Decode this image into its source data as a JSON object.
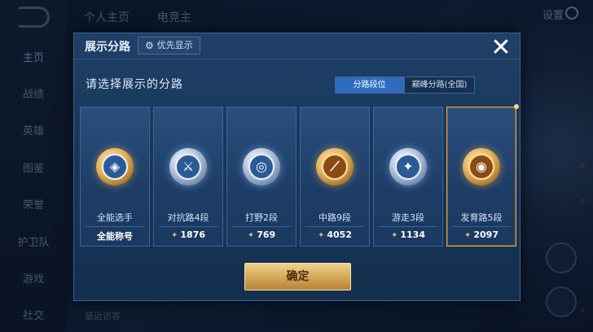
{
  "background": {
    "top_tabs": [
      "个人主页",
      "电竞主"
    ],
    "settings_label": "设置",
    "nav_items": [
      "主页",
      "战绩",
      "英雄",
      "图鉴",
      "荣誉",
      "护卫队",
      "游戏",
      "社交"
    ],
    "bottom_hint": "最近访客"
  },
  "dialog": {
    "title": "展示分路",
    "priority_button": "优先显示",
    "close_symbol": "✕",
    "prompt": "请选择展示的分路",
    "segments": [
      "分路段位",
      "巅峰分路(全国)"
    ],
    "cards": [
      {
        "label": "全能选手",
        "score": "全能称号",
        "emblem": "allround-emblem-icon",
        "glyph": "◈",
        "style": "gold-ring"
      },
      {
        "label": "对抗路4段",
        "score": "1876",
        "emblem": "clash-lane-emblem-icon",
        "glyph": "⚔",
        "style": "silver"
      },
      {
        "label": "打野2段",
        "score": "769",
        "emblem": "jungle-emblem-icon",
        "glyph": "◎",
        "style": "silver"
      },
      {
        "label": "中路9段",
        "score": "4052",
        "emblem": "mid-lane-emblem-icon",
        "glyph": "⟋",
        "style": "gold"
      },
      {
        "label": "游走3段",
        "score": "1134",
        "emblem": "roam-emblem-icon",
        "glyph": "✦",
        "style": "silver"
      },
      {
        "label": "发育路5段",
        "score": "2097",
        "emblem": "farm-lane-emblem-icon",
        "glyph": "◉",
        "style": "gold"
      }
    ],
    "selected_index": 5,
    "confirm_button": "确定"
  },
  "colors": {
    "accent_blue": "#2f6cc0",
    "gold": "#d4a95a",
    "panel": "#1f4068"
  }
}
